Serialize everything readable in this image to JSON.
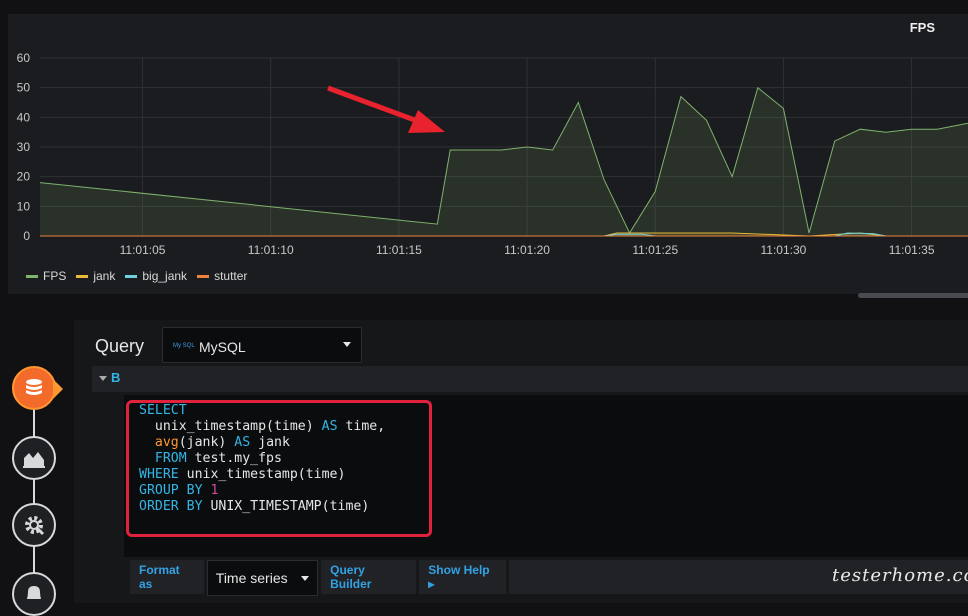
{
  "panel": {
    "title": "FPS",
    "legend": [
      {
        "name": "FPS",
        "color": "#7eb26d"
      },
      {
        "name": "jank",
        "color": "#eab839"
      },
      {
        "name": "big_jank",
        "color": "#6ed0e0"
      },
      {
        "name": "stutter",
        "color": "#ef843c"
      }
    ]
  },
  "chart_data": {
    "type": "area",
    "title": "FPS",
    "xlabel": "",
    "ylabel": "",
    "ylim": [
      0,
      60
    ],
    "yticks": [
      0,
      10,
      20,
      30,
      40,
      50,
      60
    ],
    "xticks": [
      "11:01:05",
      "11:01:10",
      "11:01:15",
      "11:01:20",
      "11:01:25",
      "11:01:30",
      "11:01:35"
    ],
    "xlim": [
      "11:01:01",
      "11:01:37.2"
    ],
    "grid": true,
    "legend_position": "bottom-left",
    "series": [
      {
        "name": "FPS",
        "color": "#7eb26d",
        "points": [
          [
            "11:01:01",
            18
          ],
          [
            "11:01:16.5",
            4
          ],
          [
            "11:01:17",
            29
          ],
          [
            "11:01:19",
            29
          ],
          [
            "11:01:20",
            30
          ],
          [
            "11:01:21",
            29
          ],
          [
            "11:01:22",
            45
          ],
          [
            "11:01:23",
            19
          ],
          [
            "11:01:24",
            1
          ],
          [
            "11:01:25",
            15
          ],
          [
            "11:01:26",
            47
          ],
          [
            "11:01:27",
            39
          ],
          [
            "11:01:28",
            20
          ],
          [
            "11:01:29",
            50
          ],
          [
            "11:01:30",
            43
          ],
          [
            "11:01:31",
            1
          ],
          [
            "11:01:32",
            32
          ],
          [
            "11:01:33",
            36
          ],
          [
            "11:01:34",
            35
          ],
          [
            "11:01:35",
            36
          ],
          [
            "11:01:36",
            36
          ],
          [
            "11:01:37.2",
            38
          ]
        ]
      },
      {
        "name": "jank",
        "color": "#eab839",
        "points": [
          [
            "11:01:01",
            0
          ],
          [
            "11:01:23",
            0
          ],
          [
            "11:01:23.5",
            1
          ],
          [
            "11:01:25",
            1
          ],
          [
            "11:01:28",
            1
          ],
          [
            "11:01:31",
            0
          ],
          [
            "11:01:33",
            1
          ],
          [
            "11:01:34",
            0
          ],
          [
            "11:01:37.2",
            0
          ]
        ]
      },
      {
        "name": "big_jank",
        "color": "#6ed0e0",
        "points": [
          [
            "11:01:01",
            0
          ],
          [
            "11:01:23",
            0
          ],
          [
            "11:01:23.5",
            0.6
          ],
          [
            "11:01:24.5",
            0.6
          ],
          [
            "11:01:25",
            0
          ],
          [
            "11:01:32",
            0
          ],
          [
            "11:01:32.5",
            1
          ],
          [
            "11:01:33.5",
            0.8
          ],
          [
            "11:01:34",
            0
          ],
          [
            "11:01:37.2",
            0
          ]
        ]
      },
      {
        "name": "stutter",
        "color": "#ef843c",
        "points": [
          [
            "11:01:01",
            0
          ],
          [
            "11:01:37.2",
            0
          ]
        ]
      }
    ]
  },
  "editor": {
    "query_label": "Query",
    "datasource": {
      "name": "MySQL",
      "logo_text": "My SQL"
    },
    "row_ref": "B",
    "sql_lines": [
      [
        {
          "t": "SELECT",
          "c": "kw"
        }
      ],
      [
        {
          "t": "  unix_timestamp(time) ",
          "c": "fn"
        },
        {
          "t": "AS",
          "c": "kw"
        },
        {
          "t": " time,",
          "c": "fn"
        }
      ],
      [
        {
          "t": "  ",
          "c": "fn"
        },
        {
          "t": "avg",
          "c": "op"
        },
        {
          "t": "(jank) ",
          "c": "fn"
        },
        {
          "t": "AS",
          "c": "kw"
        },
        {
          "t": " jank",
          "c": "fn"
        }
      ],
      [
        {
          "t": "  FROM",
          "c": "kw"
        },
        {
          "t": " test.my_fps",
          "c": "fn"
        }
      ],
      [
        {
          "t": "WHERE",
          "c": "kw"
        },
        {
          "t": " unix_timestamp(time)",
          "c": "fn"
        }
      ],
      [
        {
          "t": "GROUP BY",
          "c": "kw"
        },
        {
          "t": " ",
          "c": "fn"
        },
        {
          "t": "1",
          "c": "num"
        }
      ],
      [
        {
          "t": "ORDER BY",
          "c": "kw"
        },
        {
          "t": " UNIX_TIMESTAMP(time)",
          "c": "fn"
        }
      ]
    ],
    "toolbar": {
      "format_as_label": "Format as",
      "format_value": "Time series",
      "query_builder_label": "Query Builder",
      "show_help_label": "Show Help ▸"
    }
  },
  "rail": {
    "icons": [
      "database-icon",
      "chart-icon",
      "gear-icon",
      "bell-icon"
    ],
    "active": "database-icon"
  },
  "watermark": "testerhome.com"
}
